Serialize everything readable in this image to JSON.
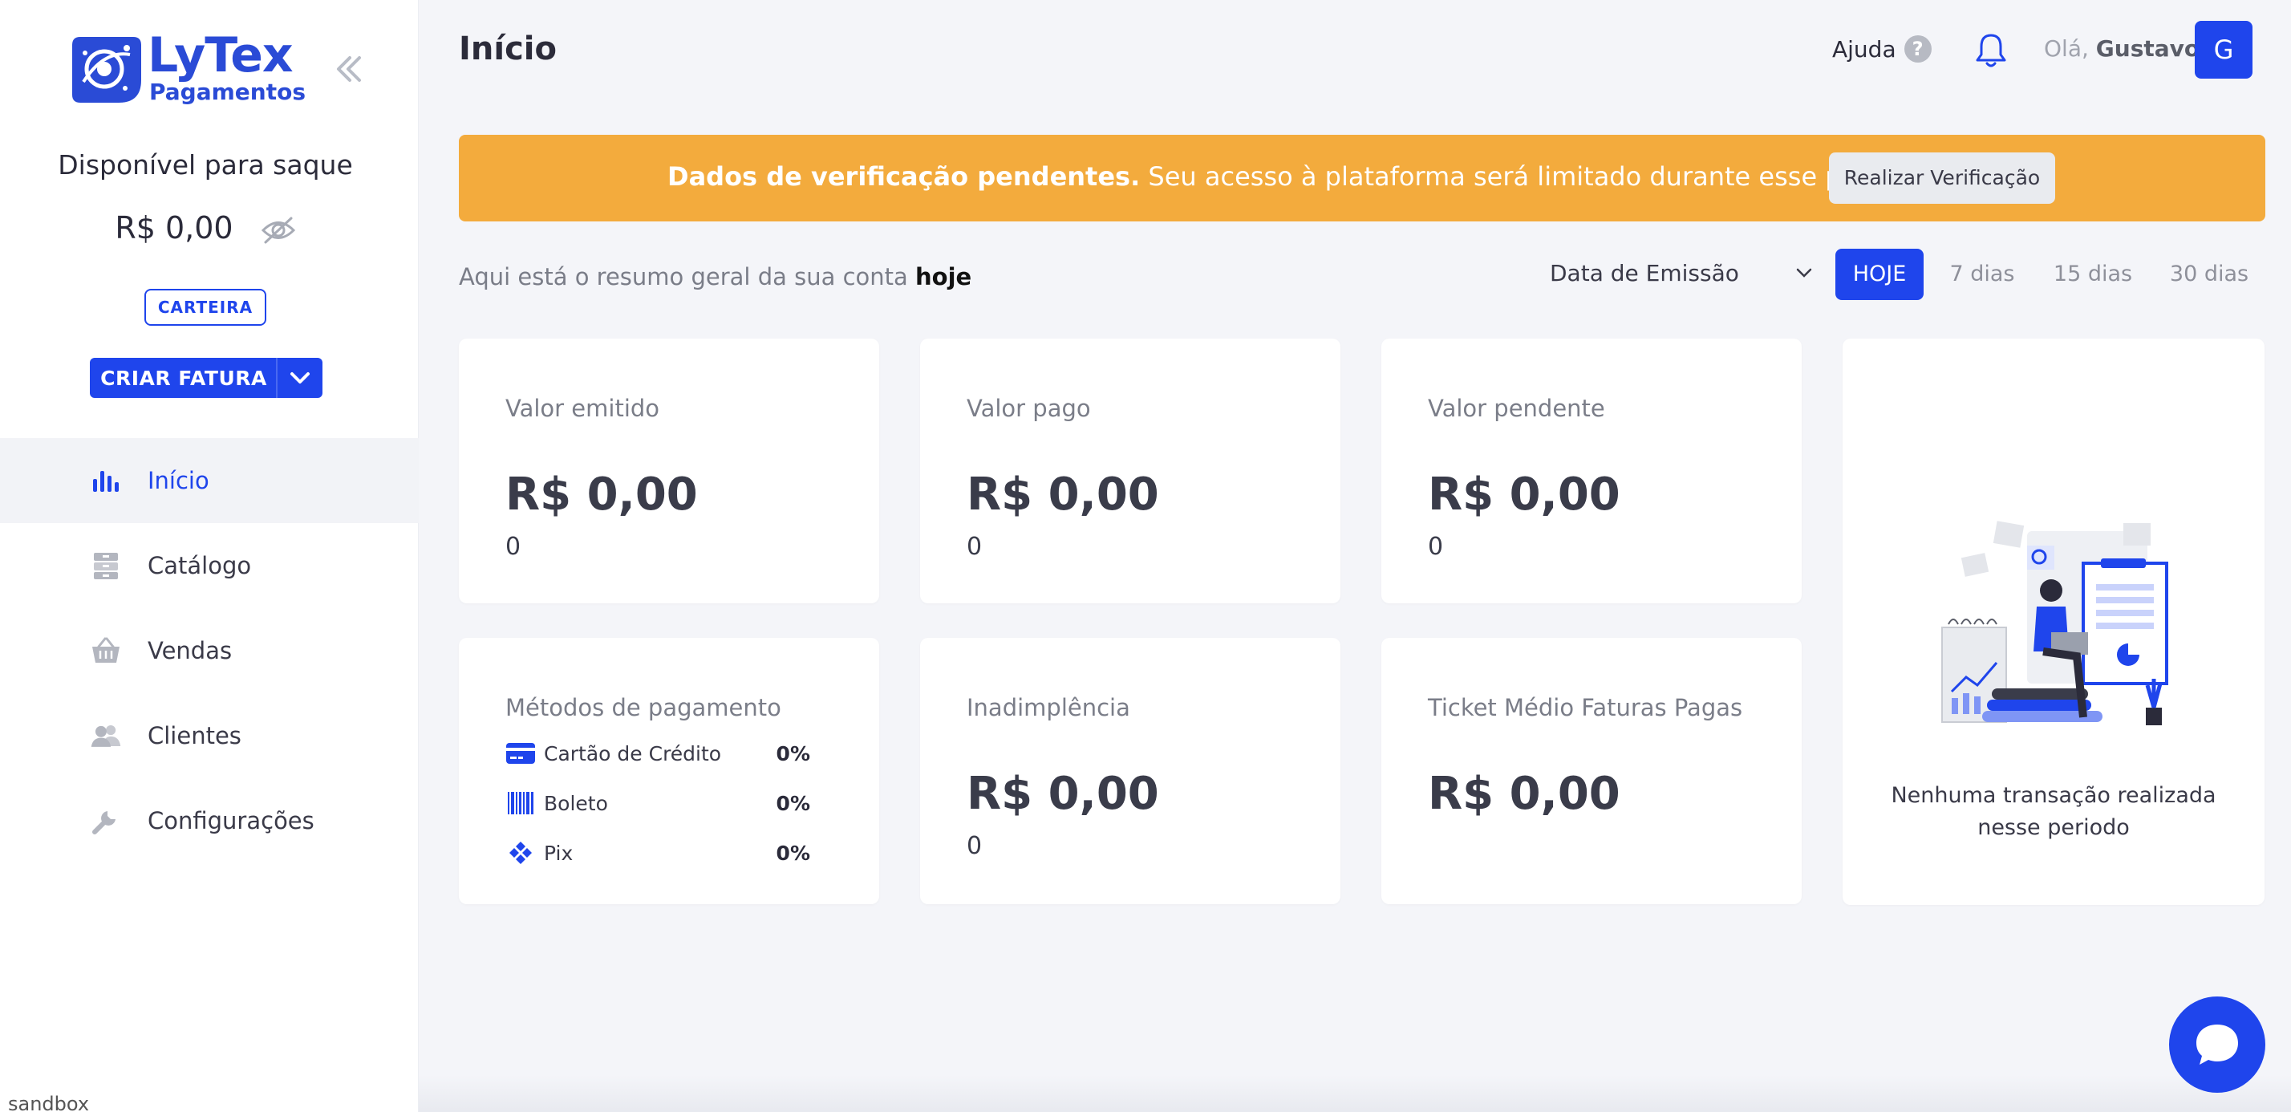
{
  "brand": {
    "name_line1": "LyTex",
    "name_line2": "Pagamentos",
    "primary_color": "#1f45ec",
    "warning_color": "#f3ab3d"
  },
  "sidebar": {
    "balance_title": "Disponível para saque",
    "balance_value": "R$ 0,00",
    "wallet_label": "CARTEIRA",
    "create_invoice_label": "CRIAR FATURA",
    "items": [
      {
        "label": "Início",
        "icon": "bar-chart-icon",
        "active": true
      },
      {
        "label": "Catálogo",
        "icon": "archive-icon",
        "active": false
      },
      {
        "label": "Vendas",
        "icon": "basket-icon",
        "active": false
      },
      {
        "label": "Clientes",
        "icon": "users-icon",
        "active": false
      },
      {
        "label": "Configurações",
        "icon": "wrench-icon",
        "active": false
      }
    ],
    "environment": "sandbox"
  },
  "header": {
    "title": "Início",
    "help_label": "Ajuda",
    "greeting_prefix": "Olá,",
    "user_name": "Gustavo",
    "avatar_initial": "G"
  },
  "banner": {
    "bold_text": "Dados de verificação pendentes.",
    "text": " Seu acesso à plataforma será limitado durante esse período.",
    "button_label": "Realizar Verificação"
  },
  "summary": {
    "prefix": "Aqui está o resumo geral da sua conta ",
    "period_word": "hoje",
    "date_filter": "Data de Emissão",
    "periods": [
      "HOJE",
      "7 dias",
      "15 dias",
      "30 dias"
    ],
    "active_period": "HOJE"
  },
  "cards": {
    "emitted": {
      "label": "Valor emitido",
      "value": "R$ 0,00",
      "count": "0"
    },
    "paid": {
      "label": "Valor pago",
      "value": "R$ 0,00",
      "count": "0"
    },
    "pending": {
      "label": "Valor pendente",
      "value": "R$ 0,00",
      "count": "0"
    },
    "methods": {
      "label": "Métodos de pagamento",
      "items": [
        {
          "name": "Cartão de Crédito",
          "pct": "0%"
        },
        {
          "name": "Boleto",
          "pct": "0%"
        },
        {
          "name": "Pix",
          "pct": "0%"
        }
      ]
    },
    "default": {
      "label": "Inadimplência",
      "value": "R$ 0,00",
      "count": "0"
    },
    "ticket": {
      "label": "Ticket Médio Faturas Pagas",
      "value": "R$ 0,00"
    },
    "empty": {
      "text": "Nenhuma transação realizada nesse periodo"
    }
  }
}
